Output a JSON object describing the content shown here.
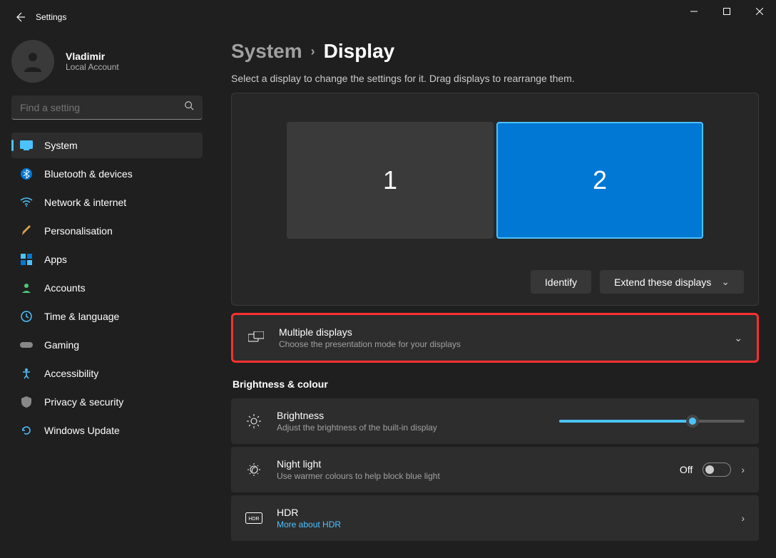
{
  "window": {
    "title": "Settings"
  },
  "user": {
    "name": "Vladimir",
    "account_type": "Local Account"
  },
  "search": {
    "placeholder": "Find a setting"
  },
  "nav": [
    {
      "label": "System",
      "icon": "system",
      "active": true
    },
    {
      "label": "Bluetooth & devices",
      "icon": "bluetooth"
    },
    {
      "label": "Network & internet",
      "icon": "wifi"
    },
    {
      "label": "Personalisation",
      "icon": "brush"
    },
    {
      "label": "Apps",
      "icon": "apps"
    },
    {
      "label": "Accounts",
      "icon": "person"
    },
    {
      "label": "Time & language",
      "icon": "clock"
    },
    {
      "label": "Gaming",
      "icon": "game"
    },
    {
      "label": "Accessibility",
      "icon": "access"
    },
    {
      "label": "Privacy & security",
      "icon": "shield"
    },
    {
      "label": "Windows Update",
      "icon": "update"
    }
  ],
  "breadcrumb": {
    "parent": "System",
    "current": "Display"
  },
  "subtitle": "Select a display to change the settings for it. Drag displays to rearrange them.",
  "monitors": {
    "m1": "1",
    "m2": "2"
  },
  "actions": {
    "identify": "Identify",
    "extend": "Extend these displays"
  },
  "multiple_displays": {
    "title": "Multiple displays",
    "sub": "Choose the presentation mode for your displays"
  },
  "section_bc": "Brightness & colour",
  "brightness": {
    "title": "Brightness",
    "sub": "Adjust the brightness of the built-in display",
    "value_pct": 72
  },
  "night_light": {
    "title": "Night light",
    "sub": "Use warmer colours to help block blue light",
    "state": "Off"
  },
  "hdr": {
    "title": "HDR",
    "link": "More about HDR"
  }
}
